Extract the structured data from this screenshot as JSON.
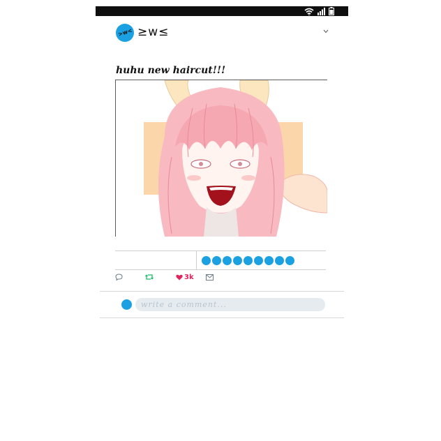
{
  "profile": {
    "username": "≥w≤"
  },
  "post": {
    "caption": "huhu new haircut!!!"
  },
  "stats": {
    "liker_count": 9
  },
  "actions": {
    "like_count": "3k"
  },
  "comment": {
    "placeholder": "write a comment..."
  },
  "colors": {
    "accent": "#1ba1e2",
    "like": "#e0245e",
    "retweet": "#17bf63",
    "statusbar": "#0f0f0f"
  },
  "icons": [
    "wifi-icon",
    "signal-icon",
    "battery-icon",
    "chevron-down-icon",
    "reply-icon",
    "retweet-icon",
    "heart-icon",
    "mail-icon"
  ]
}
